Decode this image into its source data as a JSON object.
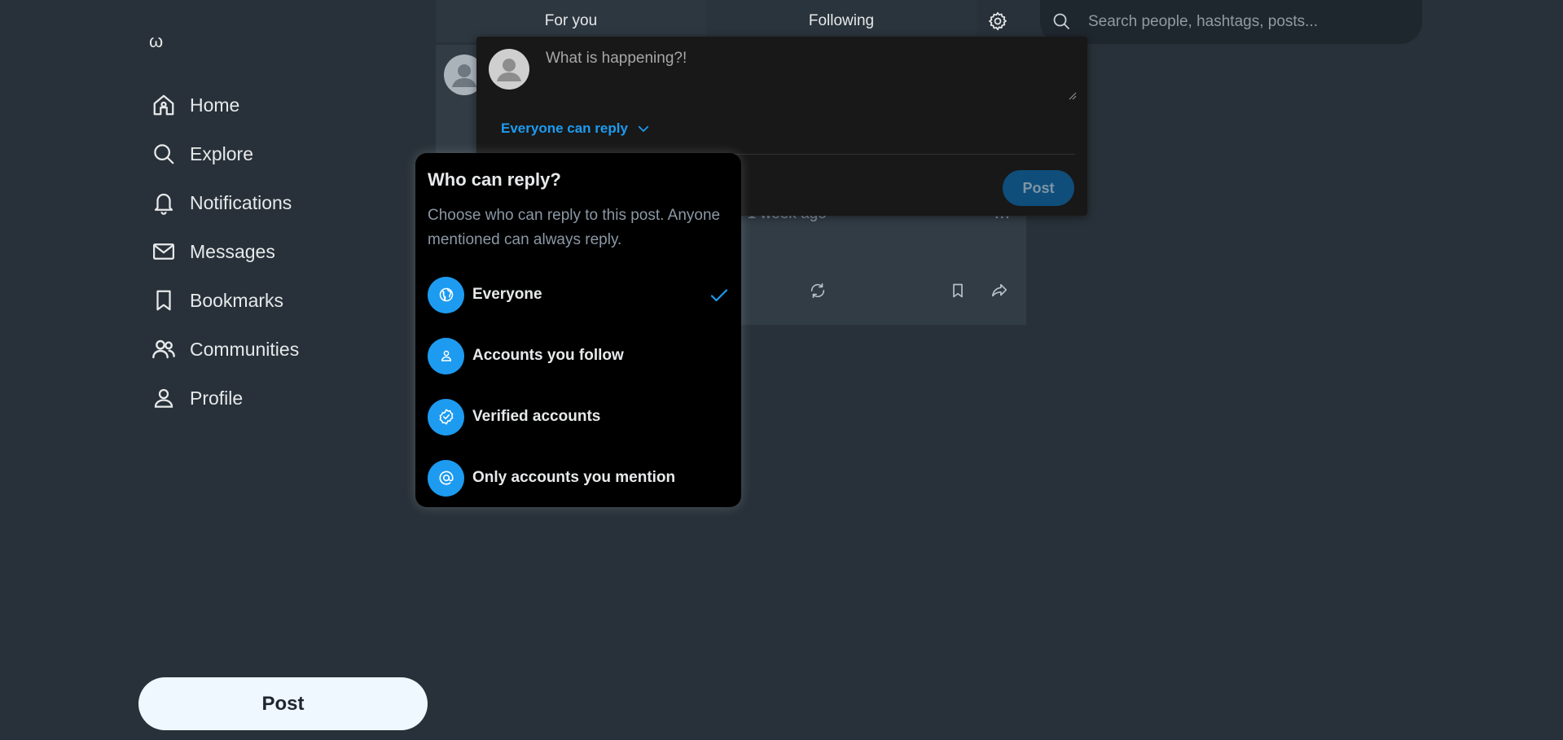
{
  "logo": {
    "glyph": "ω"
  },
  "sidebar": {
    "items": [
      {
        "label": "Home",
        "icon": "home-icon"
      },
      {
        "label": "Explore",
        "icon": "search-icon"
      },
      {
        "label": "Notifications",
        "icon": "bell-icon"
      },
      {
        "label": "Messages",
        "icon": "envelope-icon"
      },
      {
        "label": "Bookmarks",
        "icon": "bookmark-icon"
      },
      {
        "label": "Communities",
        "icon": "people-icon"
      },
      {
        "label": "Profile",
        "icon": "person-icon"
      }
    ],
    "post_label": "Post"
  },
  "tabs": {
    "for_you": "For you",
    "following": "Following",
    "settings_icon": "gear-icon"
  },
  "search": {
    "placeholder": "Search people, hashtags, posts..."
  },
  "feed_post": {
    "time": "· 1 week ago",
    "more": "..."
  },
  "composer": {
    "placeholder": "What is happening?!",
    "audience": "Everyone can reply",
    "post_label": "Post"
  },
  "reply_menu": {
    "title": "Who can reply?",
    "description": "Choose who can reply to this post. Anyone mentioned can always reply.",
    "selected": "Everyone",
    "options": [
      {
        "label": "Everyone",
        "icon": "globe-icon"
      },
      {
        "label": "Accounts you follow",
        "icon": "person-icon"
      },
      {
        "label": "Verified accounts",
        "icon": "verified-badge-icon"
      },
      {
        "label": "Only accounts you mention",
        "icon": "at-sign-icon"
      }
    ]
  },
  "colors": {
    "accent": "#1d9bf0",
    "background": "#283139",
    "menu": "#000000",
    "composer": "#181818"
  }
}
